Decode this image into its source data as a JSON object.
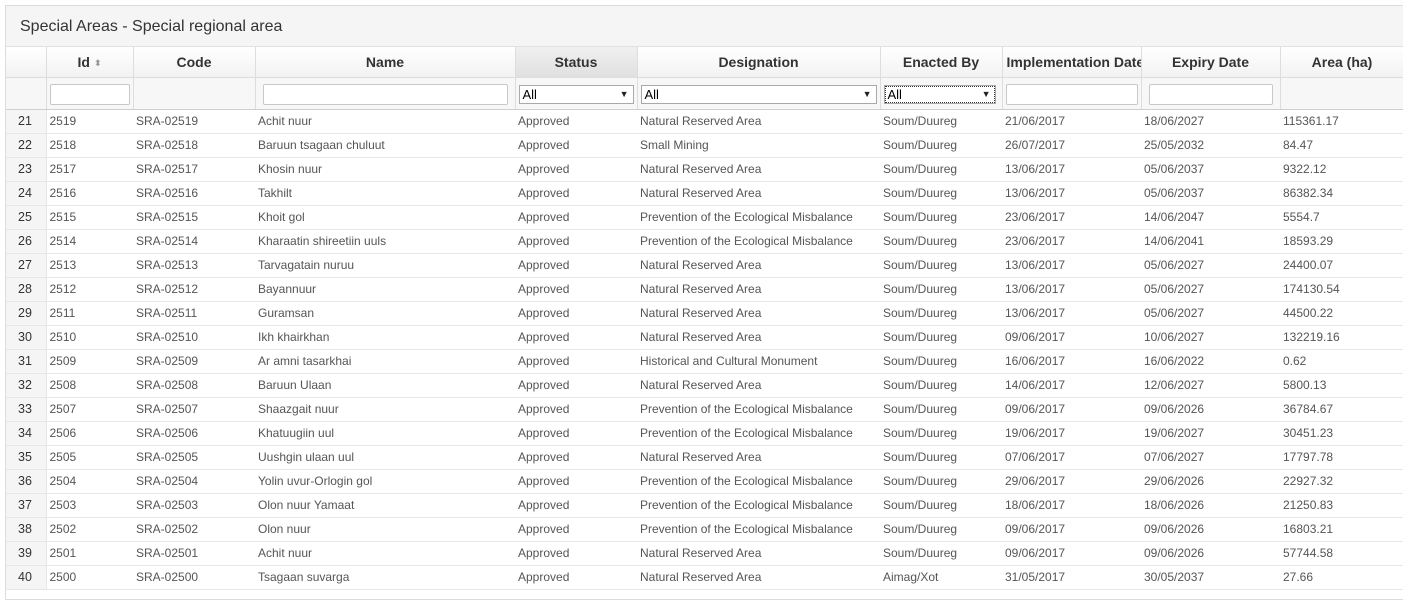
{
  "caption": "Special Areas - Special regional area",
  "columns": {
    "id": "Id",
    "code": "Code",
    "name": "Name",
    "status": "Status",
    "designation": "Designation",
    "enacted_by": "Enacted By",
    "implementation_date": "Implementation Date",
    "expiry_date": "Expiry Date",
    "area": "Area (ha)"
  },
  "icons": {
    "sort": "sort-icon",
    "dropdown": "chevron-down-icon"
  },
  "filters": {
    "status_value": "All",
    "designation_value": "All",
    "enacted_by_value": "All",
    "id_value": "",
    "name_value": "",
    "implementation_date_value": "",
    "expiry_date_value": ""
  },
  "rows": [
    {
      "rn": "21",
      "id": "2519",
      "code": "SRA-02519",
      "name": "Achit nuur",
      "status": "Approved",
      "designation": "Natural Reserved Area",
      "enacted_by": "Soum/Duureg",
      "impl": "21/06/2017",
      "exp": "18/06/2027",
      "area": "115361.17"
    },
    {
      "rn": "22",
      "id": "2518",
      "code": "SRA-02518",
      "name": "Baruun tsagaan chuluut",
      "status": "Approved",
      "designation": "Small Mining",
      "enacted_by": "Soum/Duureg",
      "impl": "26/07/2017",
      "exp": "25/05/2032",
      "area": "84.47"
    },
    {
      "rn": "23",
      "id": "2517",
      "code": "SRA-02517",
      "name": "Khosin nuur",
      "status": "Approved",
      "designation": "Natural Reserved Area",
      "enacted_by": "Soum/Duureg",
      "impl": "13/06/2017",
      "exp": "05/06/2037",
      "area": "9322.12"
    },
    {
      "rn": "24",
      "id": "2516",
      "code": "SRA-02516",
      "name": "Takhilt",
      "status": "Approved",
      "designation": "Natural Reserved Area",
      "enacted_by": "Soum/Duureg",
      "impl": "13/06/2017",
      "exp": "05/06/2037",
      "area": "86382.34"
    },
    {
      "rn": "25",
      "id": "2515",
      "code": "SRA-02515",
      "name": "Khoit gol",
      "status": "Approved",
      "designation": "Prevention of the Ecological Misbalance",
      "enacted_by": "Soum/Duureg",
      "impl": "23/06/2017",
      "exp": "14/06/2047",
      "area": "5554.7"
    },
    {
      "rn": "26",
      "id": "2514",
      "code": "SRA-02514",
      "name": "Kharaatin shireetiin uuls",
      "status": "Approved",
      "designation": "Prevention of the Ecological Misbalance",
      "enacted_by": "Soum/Duureg",
      "impl": "23/06/2017",
      "exp": "14/06/2041",
      "area": "18593.29"
    },
    {
      "rn": "27",
      "id": "2513",
      "code": "SRA-02513",
      "name": "Tarvagatain nuruu",
      "status": "Approved",
      "designation": "Natural Reserved Area",
      "enacted_by": "Soum/Duureg",
      "impl": "13/06/2017",
      "exp": "05/06/2027",
      "area": "24400.07"
    },
    {
      "rn": "28",
      "id": "2512",
      "code": "SRA-02512",
      "name": "Bayannuur",
      "status": "Approved",
      "designation": "Natural Reserved Area",
      "enacted_by": "Soum/Duureg",
      "impl": "13/06/2017",
      "exp": "05/06/2027",
      "area": "174130.54"
    },
    {
      "rn": "29",
      "id": "2511",
      "code": "SRA-02511",
      "name": "Guramsan",
      "status": "Approved",
      "designation": "Natural Reserved Area",
      "enacted_by": "Soum/Duureg",
      "impl": "13/06/2017",
      "exp": "05/06/2027",
      "area": "44500.22"
    },
    {
      "rn": "30",
      "id": "2510",
      "code": "SRA-02510",
      "name": "Ikh khairkhan",
      "status": "Approved",
      "designation": "Natural Reserved Area",
      "enacted_by": "Soum/Duureg",
      "impl": "09/06/2017",
      "exp": "10/06/2027",
      "area": "132219.16"
    },
    {
      "rn": "31",
      "id": "2509",
      "code": "SRA-02509",
      "name": "Ar amni tasarkhai",
      "status": "Approved",
      "designation": "Historical and Cultural Monument",
      "enacted_by": "Soum/Duureg",
      "impl": "16/06/2017",
      "exp": "16/06/2022",
      "area": "0.62"
    },
    {
      "rn": "32",
      "id": "2508",
      "code": "SRA-02508",
      "name": "Baruun Ulaan",
      "status": "Approved",
      "designation": "Natural Reserved Area",
      "enacted_by": "Soum/Duureg",
      "impl": "14/06/2017",
      "exp": "12/06/2027",
      "area": "5800.13"
    },
    {
      "rn": "33",
      "id": "2507",
      "code": "SRA-02507",
      "name": "Shaazgait nuur",
      "status": "Approved",
      "designation": "Prevention of the Ecological Misbalance",
      "enacted_by": "Soum/Duureg",
      "impl": "09/06/2017",
      "exp": "09/06/2026",
      "area": "36784.67"
    },
    {
      "rn": "34",
      "id": "2506",
      "code": "SRA-02506",
      "name": "Khatuugiin uul",
      "status": "Approved",
      "designation": "Prevention of the Ecological Misbalance",
      "enacted_by": "Soum/Duureg",
      "impl": "19/06/2017",
      "exp": "19/06/2027",
      "area": "30451.23"
    },
    {
      "rn": "35",
      "id": "2505",
      "code": "SRA-02505",
      "name": "Uushgin ulaan uul",
      "status": "Approved",
      "designation": "Natural Reserved Area",
      "enacted_by": "Soum/Duureg",
      "impl": "07/06/2017",
      "exp": "07/06/2027",
      "area": "17797.78"
    },
    {
      "rn": "36",
      "id": "2504",
      "code": "SRA-02504",
      "name": "Yolin uvur-Orlogin gol",
      "status": "Approved",
      "designation": "Prevention of the Ecological Misbalance",
      "enacted_by": "Soum/Duureg",
      "impl": "29/06/2017",
      "exp": "29/06/2026",
      "area": "22927.32"
    },
    {
      "rn": "37",
      "id": "2503",
      "code": "SRA-02503",
      "name": "Olon nuur Yamaat",
      "status": "Approved",
      "designation": "Prevention of the Ecological Misbalance",
      "enacted_by": "Soum/Duureg",
      "impl": "18/06/2017",
      "exp": "18/06/2026",
      "area": "21250.83"
    },
    {
      "rn": "38",
      "id": "2502",
      "code": "SRA-02502",
      "name": "Olon nuur",
      "status": "Approved",
      "designation": "Prevention of the Ecological Misbalance",
      "enacted_by": "Soum/Duureg",
      "impl": "09/06/2017",
      "exp": "09/06/2026",
      "area": "16803.21"
    },
    {
      "rn": "39",
      "id": "2501",
      "code": "SRA-02501",
      "name": "Achit nuur",
      "status": "Approved",
      "designation": "Natural Reserved Area",
      "enacted_by": "Soum/Duureg",
      "impl": "09/06/2017",
      "exp": "09/06/2026",
      "area": "57744.58"
    },
    {
      "rn": "40",
      "id": "2500",
      "code": "SRA-02500",
      "name": "Tsagaan suvarga",
      "status": "Approved",
      "designation": "Natural Reserved Area",
      "enacted_by": "Aimag/Xot",
      "impl": "31/05/2017",
      "exp": "30/05/2037",
      "area": "27.66"
    }
  ]
}
